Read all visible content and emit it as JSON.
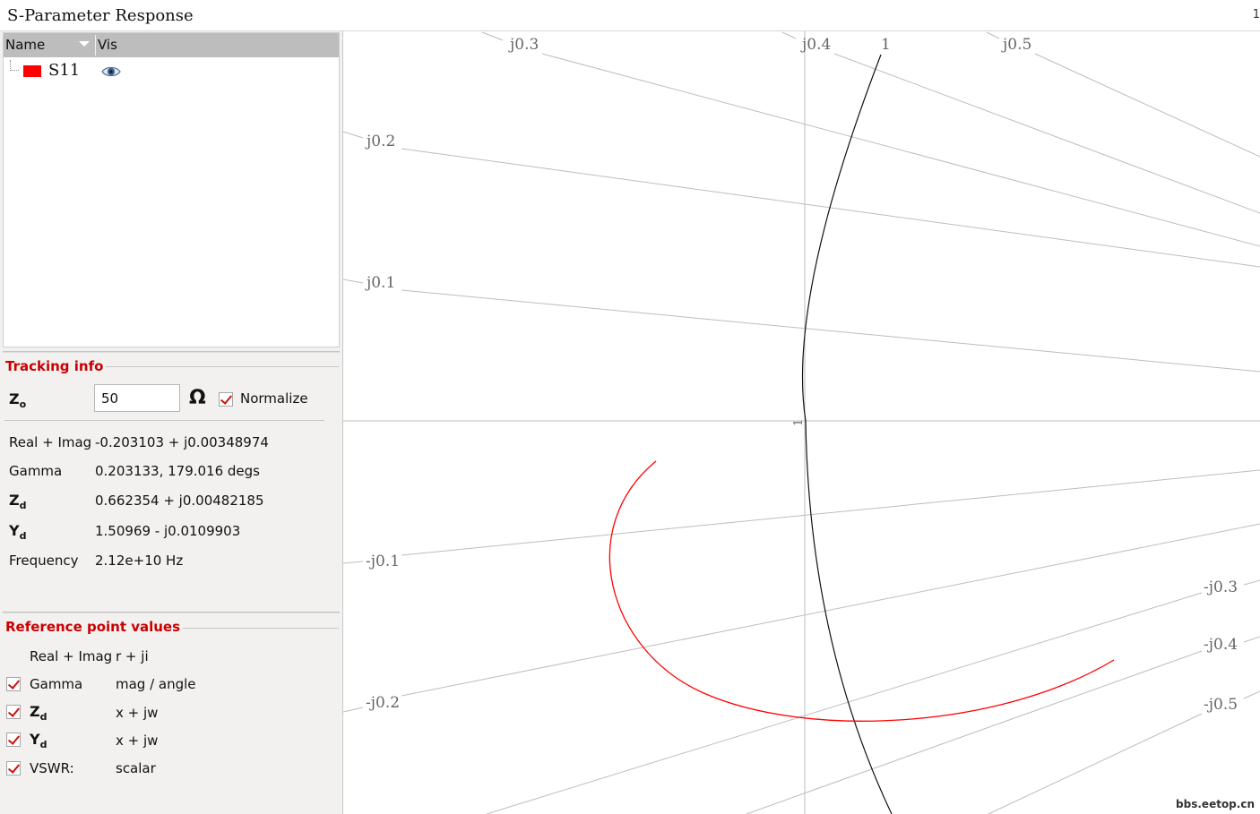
{
  "window": {
    "title": "S-Parameter Response",
    "corner_glyph": "1"
  },
  "tree": {
    "columns": {
      "name": "Name",
      "vis": "Vis"
    },
    "rows": [
      {
        "label": "S11",
        "color": "#ff0000",
        "icon": "eye-icon"
      }
    ]
  },
  "tracking": {
    "title": "Tracking info",
    "zo_label": "Z",
    "zo_sub": "o",
    "zo_value": "50",
    "ohm_symbol": "Ω",
    "normalize_label": "Normalize",
    "normalize_checked": true,
    "rows": [
      {
        "label": "Real + Imag",
        "value": "-0.203103 + j0.00348974"
      },
      {
        "label": "Gamma",
        "value": "0.203133, 179.016 degs"
      },
      {
        "label": "Z",
        "sub": "d",
        "value": "0.662354 + j0.00482185"
      },
      {
        "label": "Y",
        "sub": "d",
        "value": "1.50969 - j0.0109903"
      },
      {
        "label": "Frequency",
        "value": "2.12e+10 Hz"
      }
    ]
  },
  "reference": {
    "title": "Reference point values",
    "rows": [
      {
        "label": "Real + Imag",
        "format": "r + ji",
        "checked": null
      },
      {
        "label": "Gamma",
        "format": "mag / angle",
        "checked": true
      },
      {
        "label": "Z",
        "sub": "d",
        "format": "x + jw",
        "checked": true
      },
      {
        "label": "Y",
        "sub": "d",
        "format": "x + jw",
        "checked": true
      },
      {
        "label": "VSWR:",
        "format": "scalar",
        "checked": true
      }
    ]
  },
  "chart_data": {
    "type": "smith",
    "grid_color": "#bdbdbd",
    "trace_color": "#ff0000",
    "resistance_circle_color": "#111111",
    "top_labels": [
      "j0.3",
      "j0.4",
      "1",
      "j0.5"
    ],
    "left_labels": [
      "j0.2",
      "j0.1",
      "-j0.1",
      "-j0.2"
    ],
    "right_labels": [
      "-j0.3",
      "-j0.4",
      "-j0.5"
    ],
    "center_label": "1"
  },
  "watermark": "bbs.eetop.cn"
}
